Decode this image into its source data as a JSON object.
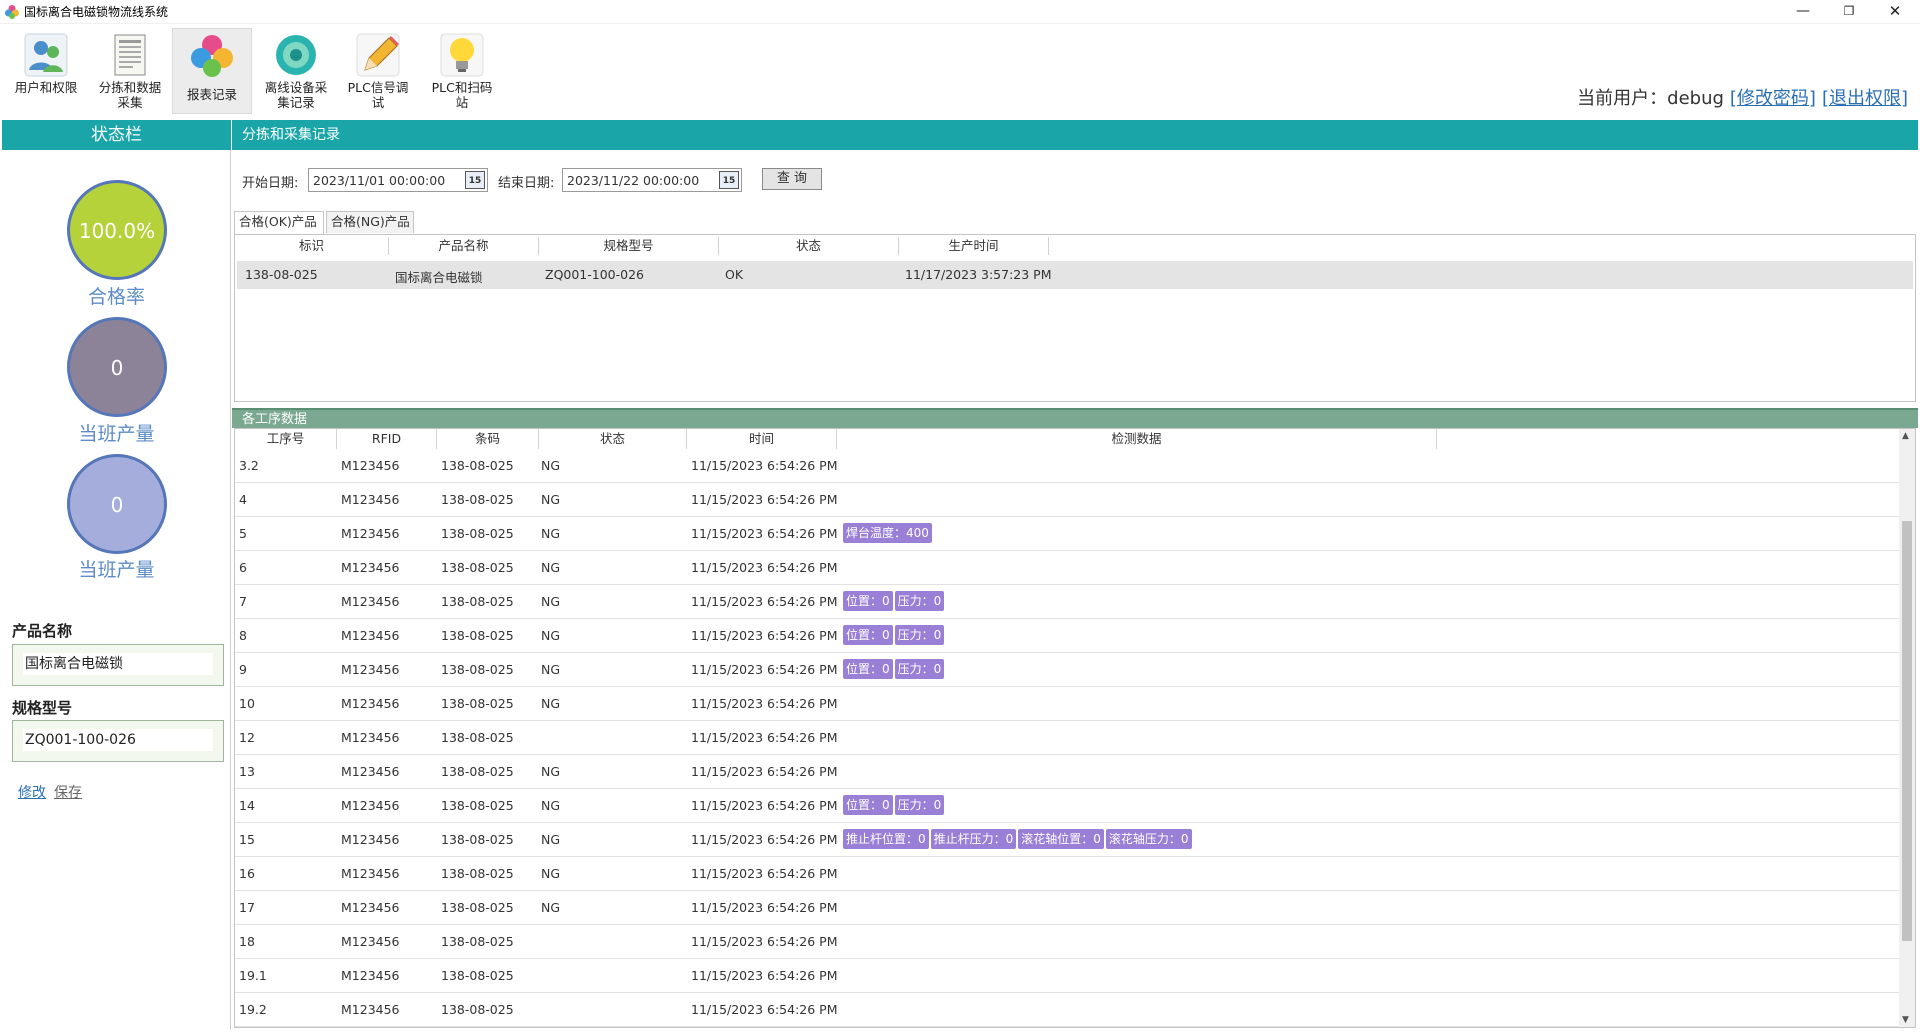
{
  "window": {
    "title": "国标离合电磁锁物流线系统"
  },
  "toolbar": [
    {
      "label": "用户和权限",
      "icon": "users-icon"
    },
    {
      "label": "分拣和数据采集",
      "icon": "document-icon"
    },
    {
      "label": "报表记录",
      "icon": "clover-icon"
    },
    {
      "label": "离线设备采集记录",
      "icon": "disc-icon"
    },
    {
      "label": "PLC信号调试",
      "icon": "pencil-icon"
    },
    {
      "label": "PLC和扫码站",
      "icon": "bulb-icon"
    }
  ],
  "user": {
    "prefix": "当前用户：debug",
    "change_password": "[修改密码]",
    "logout": "[退出权限]"
  },
  "sidebar": {
    "title": "状态栏",
    "stats": [
      {
        "value": "100.0%",
        "label": "合格率",
        "color": "#b5d23a"
      },
      {
        "value": "0",
        "label": "当班产量",
        "color": "#8d8399"
      },
      {
        "value": "0",
        "label": "当班产量",
        "color": "#a4addb"
      }
    ],
    "product_name_label": "产品名称",
    "product_name": "国标离合电磁锁",
    "spec_label": "规格型号",
    "spec": "ZQ001-100-026",
    "edit": "修改",
    "save": "保存"
  },
  "main": {
    "header": "分拣和采集记录",
    "start_label": "开始日期:",
    "start_date": "2023/11/01 00:00:00",
    "end_label": "结束日期:",
    "end_date": "2023/11/22 00:00:00",
    "query": "查 询",
    "calendar_icon_text": "15",
    "tabs": [
      "合格(OK)产品",
      "合格(NG)产品"
    ],
    "product_columns": [
      "标识",
      "产品名称",
      "规格型号",
      "状态",
      "生产时间"
    ],
    "product_rows": [
      [
        "138-08-025",
        "国标离合电磁锁",
        "ZQ001-100-026",
        "OK",
        "11/17/2023 3:57:23 PM"
      ]
    ]
  },
  "process": {
    "header": "各工序数据",
    "columns": [
      "工序号",
      "RFID",
      "条码",
      "状态",
      "时间",
      "检测数据"
    ],
    "rows": [
      {
        "step": "3.2",
        "rfid": "M123456",
        "code": "138-08-025",
        "status": "NG",
        "time": "11/15/2023 6:54:26 PM",
        "tags": []
      },
      {
        "step": "4",
        "rfid": "M123456",
        "code": "138-08-025",
        "status": "NG",
        "time": "11/15/2023 6:54:26 PM",
        "tags": []
      },
      {
        "step": "5",
        "rfid": "M123456",
        "code": "138-08-025",
        "status": "NG",
        "time": "11/15/2023 6:54:26 PM",
        "tags": [
          "焊台温度：400"
        ]
      },
      {
        "step": "6",
        "rfid": "M123456",
        "code": "138-08-025",
        "status": "NG",
        "time": "11/15/2023 6:54:26 PM",
        "tags": []
      },
      {
        "step": "7",
        "rfid": "M123456",
        "code": "138-08-025",
        "status": "NG",
        "time": "11/15/2023 6:54:26 PM",
        "tags": [
          "位置：0",
          "压力：0"
        ]
      },
      {
        "step": "8",
        "rfid": "M123456",
        "code": "138-08-025",
        "status": "NG",
        "time": "11/15/2023 6:54:26 PM",
        "tags": [
          "位置：0",
          "压力：0"
        ]
      },
      {
        "step": "9",
        "rfid": "M123456",
        "code": "138-08-025",
        "status": "NG",
        "time": "11/15/2023 6:54:26 PM",
        "tags": [
          "位置：0",
          "压力：0"
        ]
      },
      {
        "step": "10",
        "rfid": "M123456",
        "code": "138-08-025",
        "status": "NG",
        "time": "11/15/2023 6:54:26 PM",
        "tags": []
      },
      {
        "step": "12",
        "rfid": "M123456",
        "code": "138-08-025",
        "status": "",
        "time": "11/15/2023 6:54:26 PM",
        "tags": []
      },
      {
        "step": "13",
        "rfid": "M123456",
        "code": "138-08-025",
        "status": "NG",
        "time": "11/15/2023 6:54:26 PM",
        "tags": []
      },
      {
        "step": "14",
        "rfid": "M123456",
        "code": "138-08-025",
        "status": "NG",
        "time": "11/15/2023 6:54:26 PM",
        "tags": [
          "位置：0",
          "压力：0"
        ]
      },
      {
        "step": "15",
        "rfid": "M123456",
        "code": "138-08-025",
        "status": "NG",
        "time": "11/15/2023 6:54:26 PM",
        "tags": [
          "推止杆位置：0",
          "推止杆压力：0",
          "滚花轴位置：0",
          "滚花轴压力：0"
        ]
      },
      {
        "step": "16",
        "rfid": "M123456",
        "code": "138-08-025",
        "status": "NG",
        "time": "11/15/2023 6:54:26 PM",
        "tags": []
      },
      {
        "step": "17",
        "rfid": "M123456",
        "code": "138-08-025",
        "status": "NG",
        "time": "11/15/2023 6:54:26 PM",
        "tags": []
      },
      {
        "step": "18",
        "rfid": "M123456",
        "code": "138-08-025",
        "status": "",
        "time": "11/15/2023 6:54:26 PM",
        "tags": []
      },
      {
        "step": "19.1",
        "rfid": "M123456",
        "code": "138-08-025",
        "status": "",
        "time": "11/15/2023 6:54:26 PM",
        "tags": []
      },
      {
        "step": "19.2",
        "rfid": "M123456",
        "code": "138-08-025",
        "status": "",
        "time": "11/15/2023 6:54:26 PM",
        "tags": []
      }
    ]
  }
}
